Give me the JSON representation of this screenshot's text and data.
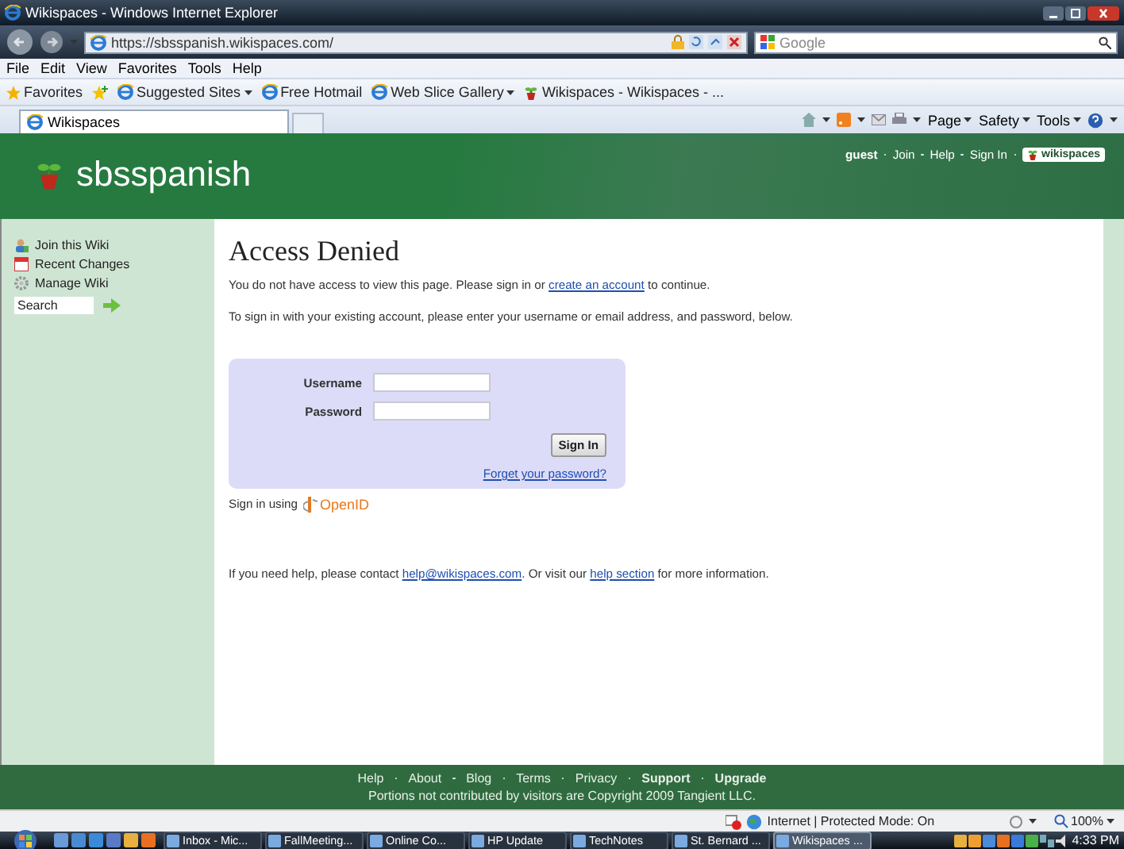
{
  "window": {
    "title": "Wikispaces - Windows Internet Explorer"
  },
  "address_bar": {
    "url": "https://sbsspanish.wikispaces.com/"
  },
  "search_box": {
    "placeholder": "Google"
  },
  "menu": [
    "File",
    "Edit",
    "View",
    "Favorites",
    "Tools",
    "Help"
  ],
  "favorites_bar": {
    "label": "Favorites",
    "links": [
      {
        "label": "Suggested Sites",
        "dropdown": true
      },
      {
        "label": "Free Hotmail",
        "dropdown": false
      },
      {
        "label": "Web Slice Gallery",
        "dropdown": true
      },
      {
        "label": "Wikispaces - Wikispaces - ...",
        "dropdown": false
      }
    ]
  },
  "tabs": [
    {
      "label": "Wikispaces",
      "selected": true
    }
  ],
  "command_bar": [
    "Page",
    "Safety",
    "Tools"
  ],
  "site": {
    "name": "sbsspanish",
    "user": "guest",
    "user_links": [
      "Join",
      "Help",
      "Sign In"
    ],
    "badge": "wikispaces"
  },
  "sidebar": {
    "items": [
      {
        "label": "Join this Wiki"
      },
      {
        "label": "Recent Changes"
      },
      {
        "label": "Manage Wiki"
      }
    ],
    "search": {
      "value": "Search"
    }
  },
  "main": {
    "title": "Access Denied",
    "intro": {
      "before": "You do not have access to view this page. Please sign in or ",
      "link": "create an account",
      "after": " to continue."
    },
    "instructions": "To sign in with your existing account, please enter your username or email address, and password, below.",
    "login": {
      "username_label": "Username",
      "password_label": "Password",
      "button": "Sign In",
      "forgot": "Forget your password?"
    },
    "openid": {
      "label": "Sign in using",
      "logo": "OpenID"
    },
    "help": {
      "parts": [
        {
          "text": "If you need help, please contact "
        },
        {
          "link": "help@wikispaces.com"
        },
        {
          "text": ". Or visit our "
        },
        {
          "link": "help section"
        },
        {
          "text": " for more information."
        }
      ]
    }
  },
  "footer": {
    "links": [
      {
        "label": "Help",
        "bold": false
      },
      {
        "label": "About",
        "bold": false
      },
      {
        "label": "Blog",
        "bold": false
      },
      {
        "label": "Terms",
        "bold": false
      },
      {
        "label": "Privacy",
        "bold": false
      },
      {
        "label": "Support",
        "bold": true
      },
      {
        "label": "Upgrade",
        "bold": true
      }
    ],
    "copyright": "Portions not contributed by visitors are Copyright 2009 Tangient LLC."
  },
  "status_bar": {
    "zone": "Internet | Protected Mode: On",
    "zoom": "100%"
  },
  "taskbar": {
    "items": [
      {
        "label": "Inbox - Mic...",
        "selected": false
      },
      {
        "label": "FallMeeting...",
        "selected": false
      },
      {
        "label": "Online Co...",
        "selected": false
      },
      {
        "label": "HP Update",
        "selected": false
      },
      {
        "label": "TechNotes",
        "selected": false
      },
      {
        "label": "St. Bernard ...",
        "selected": false
      },
      {
        "label": "Wikispaces ...",
        "selected": true
      }
    ],
    "clock": "4:33 PM"
  }
}
